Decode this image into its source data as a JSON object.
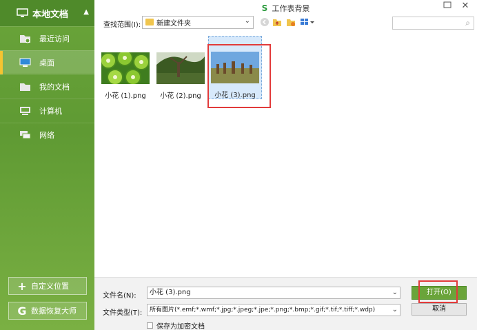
{
  "sidebar": {
    "title": "本地文档",
    "items": [
      {
        "label": "最近访问",
        "icon": "recent-folder-icon"
      },
      {
        "label": "桌面",
        "icon": "desktop-icon"
      },
      {
        "label": "我的文档",
        "icon": "documents-folder-icon"
      },
      {
        "label": "计算机",
        "icon": "computer-icon"
      },
      {
        "label": "网络",
        "icon": "network-icon"
      }
    ],
    "active_index": 1,
    "custom_location_label": "自定义位置",
    "data_recovery_label": "数据恢复大师"
  },
  "window": {
    "title": "工作表背景",
    "logo_glyph": "S"
  },
  "toolbar": {
    "scope_label": "查找范围(I):",
    "current_folder": "新建文件夹"
  },
  "files": [
    {
      "name": "小花 (1).png",
      "thumb": "kiwi"
    },
    {
      "name": "小花 (2).png",
      "thumb": "tree"
    },
    {
      "name": "小花 (3).png",
      "thumb": "field",
      "selected": true
    }
  ],
  "bottom": {
    "filename_label": "文件名(N):",
    "filename_value": "小花 (3).png",
    "filetype_label": "文件类型(T):",
    "filetype_value": "所有图片(*.emf;*.wmf;*.jpg;*.jpeg;*.jpe;*.png;*.bmp;*.gif;*.tif;*.tiff;*.wdp)",
    "open_label": "打开(O)",
    "cancel_label": "取消",
    "encrypt_label": "保存为加密文档"
  },
  "colors": {
    "sidebar_green": "#6aa43a",
    "highlight_red": "#e23a3a",
    "selection_blue": "#d7e9fb"
  }
}
